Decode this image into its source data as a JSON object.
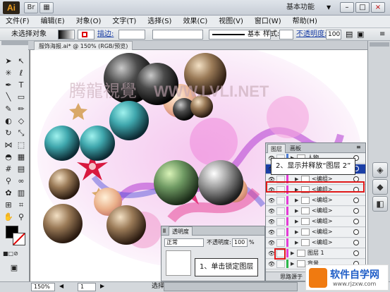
{
  "titlebar": {
    "logo": "Ai",
    "workspace": "基本功能",
    "controls": [
      "–",
      "□",
      "×"
    ]
  },
  "menu": [
    "文件(F)",
    "编辑(E)",
    "对象(O)",
    "文字(T)",
    "选择(S)",
    "效果(C)",
    "视图(V)",
    "窗口(W)",
    "帮助(H)"
  ],
  "control_bar": {
    "selection": "未选择对象",
    "stroke_label": "描边:",
    "style_label": "基本",
    "style2_label": "样式:",
    "opacity_label": "不透明度:",
    "opacity_value": "100"
  },
  "document": {
    "tab": "服饰海报.ai* @ 150% (RGB/预览)"
  },
  "canvas": {
    "watermark": "腾龍視覺",
    "watermark_url": "WWW.LVLI.NET"
  },
  "layers_panel": {
    "tabs": [
      "图层",
      "画板"
    ],
    "rows": [
      {
        "name": "人物",
        "indent": 0,
        "expanded": false,
        "selected": false,
        "swatch": "#4b7bd6"
      },
      {
        "name": "图层 2",
        "indent": 0,
        "expanded": true,
        "selected": true,
        "swatch": "#e43bd6"
      },
      {
        "name": "<编组>",
        "indent": 1,
        "expanded": false,
        "selected": false,
        "swatch": "#e43bd6"
      },
      {
        "name": "<编组>",
        "indent": 1,
        "expanded": false,
        "selected": false,
        "swatch": "#e43bd6"
      },
      {
        "name": "<编组>",
        "indent": 1,
        "expanded": false,
        "selected": false,
        "swatch": "#e43bd6"
      },
      {
        "name": "<编组>",
        "indent": 1,
        "expanded": false,
        "selected": false,
        "swatch": "#e43bd6"
      },
      {
        "name": "<编组>",
        "indent": 1,
        "expanded": false,
        "selected": false,
        "swatch": "#e43bd6"
      },
      {
        "name": "<编组>",
        "indent": 1,
        "expanded": false,
        "selected": false,
        "swatch": "#e43bd6"
      },
      {
        "name": "<编组>",
        "indent": 1,
        "expanded": false,
        "selected": false,
        "swatch": "#e43bd6"
      },
      {
        "name": "图层 1",
        "indent": 0,
        "expanded": false,
        "selected": false,
        "swatch": "#e43bd6"
      },
      {
        "name": "背景",
        "indent": 0,
        "expanded": false,
        "selected": false,
        "swatch": "#2bb84a"
      }
    ],
    "footer": "思路源于"
  },
  "transparency_panel": {
    "title": "透明度",
    "mode": "正常",
    "opacity_label": "不透明度:",
    "opacity_value": "100",
    "unit": "%"
  },
  "callouts": {
    "step1": "1、单击锁定图层",
    "step2": "2、显示并释放“图层 2”"
  },
  "status": {
    "zoom": "150%",
    "page": "1",
    "mode": "选择"
  },
  "logo_watermark": {
    "text": "软件自学网",
    "url": "www.rjzxw.com"
  },
  "colors": {
    "selection": "#1b3fa6",
    "highlight": "#e01919"
  }
}
